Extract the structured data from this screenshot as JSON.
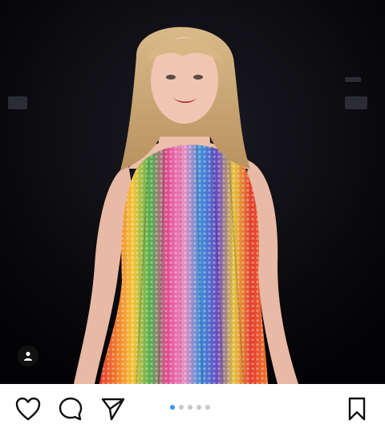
{
  "post": {
    "image": {
      "description_icon": "person-tag-icon"
    },
    "actions": {
      "like_icon": "heart-icon",
      "comment_icon": "comment-icon",
      "share_icon": "send-icon",
      "save_icon": "bookmark-icon"
    },
    "carousel": {
      "total": 5,
      "active_index": 0,
      "active_color": "#3897f0",
      "inactive_color": "#c7c7c7"
    }
  }
}
